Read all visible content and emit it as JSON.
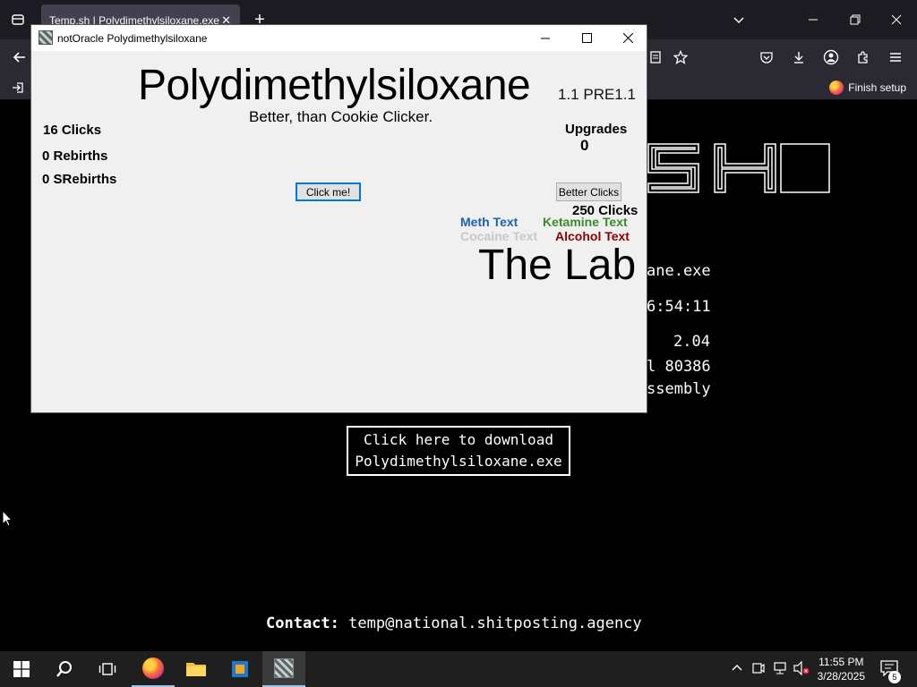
{
  "browser": {
    "tab_title": "Temp.sh | Polydimethylsiloxane.exe",
    "tab_close": "✕",
    "new_tab": "+",
    "finish_setup": "Finish setup"
  },
  "webpage": {
    "ascii_logo": "SH",
    "lines": [
      "ane.exe",
      "6:54:11",
      "2.04",
      "l 80386",
      "ssembly"
    ],
    "download_line1": "Click here to download",
    "download_line2": "Polydimethylsiloxane.exe",
    "contact_label": "Contact:",
    "contact_email": "temp@national.shitposting.agency"
  },
  "app": {
    "window_title": "notOracle Polydimethylsiloxane",
    "game_title": "Polydimethylsiloxane",
    "version": "1.1 PRE1.1",
    "tagline": "Better, than Cookie Clicker.",
    "clicks": "16 Clicks",
    "rebirths": "0 Rebirths",
    "srebirths": "0 SRebirths",
    "click_button": "Click me!",
    "upgrades_label": "Upgrades",
    "upgrades_count": "0",
    "better_clicks_button": "Better Clicks",
    "better_clicks_cost": "250 Clicks",
    "lab": {
      "meth": "Meth Text",
      "ketamine": "Ketamine Text",
      "cocaine": "Cocaine Text",
      "alcohol": "Alcohol Text",
      "title": "The Lab"
    },
    "lab_colors": {
      "meth": "#1f5fb0",
      "ketamine": "#3a8a2a",
      "cocaine": "#c8c8c8",
      "alcohol": "#8b0000"
    }
  },
  "taskbar": {
    "time": "11:55 PM",
    "date": "3/28/2025",
    "notifications": "5"
  }
}
